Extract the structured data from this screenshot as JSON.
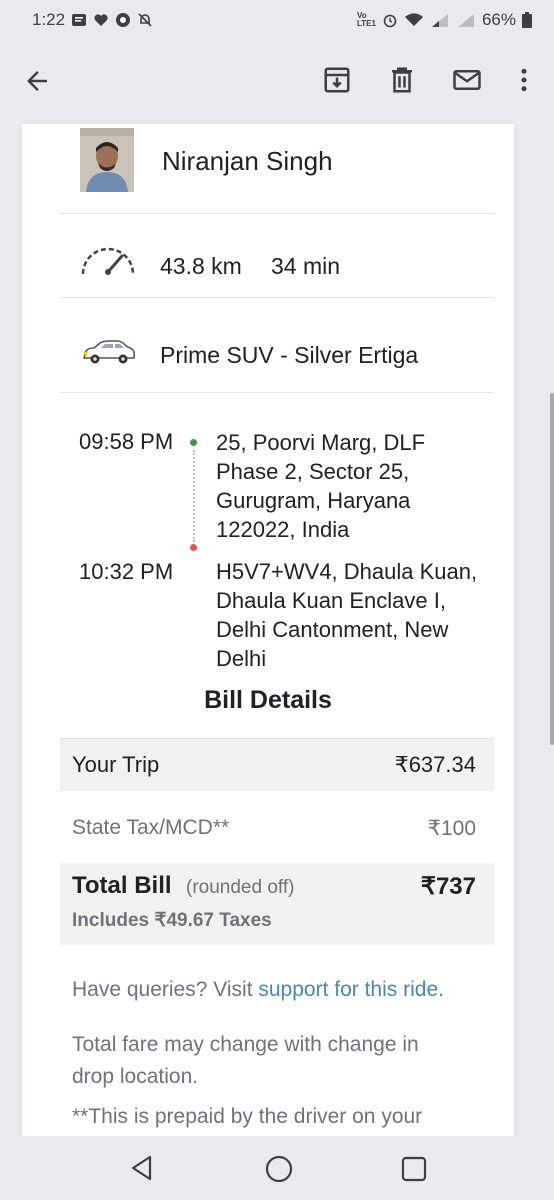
{
  "status": {
    "time": "1:22",
    "network": "Vo\nLTE1",
    "battery": "66%"
  },
  "toolbar": {
    "back_icon": "arrow-back-icon",
    "archive_icon": "archive-icon",
    "delete_icon": "trash-icon",
    "mail_icon": "mail-icon",
    "more_icon": "more-vert-icon"
  },
  "driver": {
    "name": "Niranjan Singh"
  },
  "trip": {
    "distance": "43.8 km",
    "duration": "34 min",
    "vehicle": "Prime SUV - Silver Ertiga"
  },
  "route": {
    "pickup_time": "09:58 PM",
    "pickup_address": [
      "25, Poorvi Marg, DLF",
      "Phase 2, Sector 25,",
      "Gurugram, Haryana",
      "122022, India"
    ],
    "drop_time": "10:32 PM",
    "drop_address": [
      "H5V7+WV4, Dhaula Kuan,",
      "Dhaula Kuan Enclave I,",
      "Delhi Cantonment, New",
      "Delhi"
    ]
  },
  "bill": {
    "heading": "Bill Details",
    "your_trip_label": "Your Trip",
    "your_trip_value": "₹637.34",
    "tax_label": "State Tax/MCD**",
    "tax_value": "₹100",
    "total_label": "Total Bill",
    "total_note": "(rounded off)",
    "total_value": "₹737",
    "includes": "Includes ₹49.67 Taxes"
  },
  "footer": {
    "queries_prefix": "Have queries? Visit ",
    "queries_link": "support for this ride.",
    "fare_note_1": "Total fare may change with change in",
    "fare_note_2": "drop location.",
    "prepaid_note": "**This is prepaid by the driver on your"
  },
  "colors": {
    "pickup_dot": "#3c9a3c",
    "drop_dot": "#e0574e",
    "link": "#4a86b4",
    "bill_bg": "#f1f1f1"
  }
}
